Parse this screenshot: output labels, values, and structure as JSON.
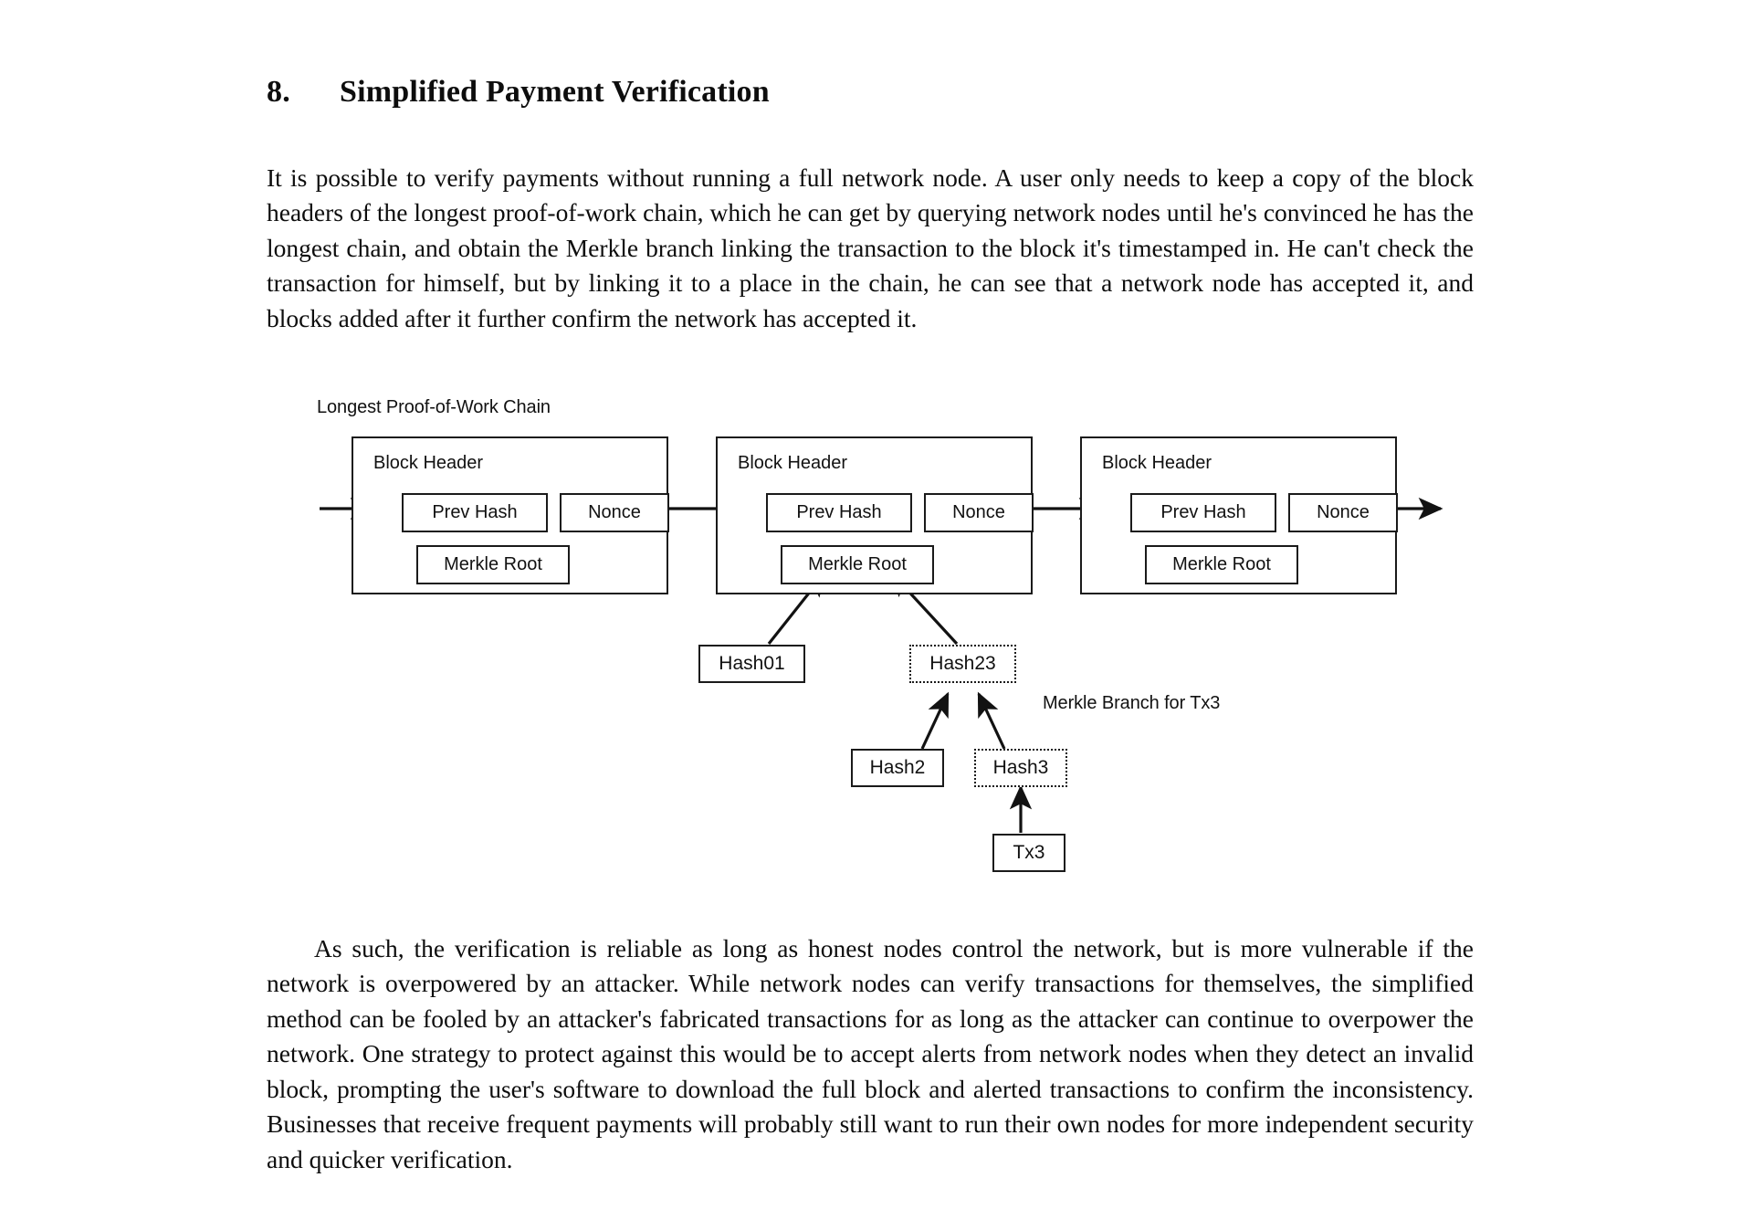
{
  "page": {
    "background": "#ffffff",
    "ink": "#0d0d0d"
  },
  "heading": {
    "number": "8.",
    "title": "Simplified Payment Verification"
  },
  "paragraphs": {
    "intro": "It is possible to verify payments without running a full network node.  A user only needs to keep a copy of the block headers of the longest proof-of-work chain, which he can get by querying network nodes until he's convinced he has the longest chain, and obtain the Merkle branch linking the transaction to the block it's timestamped in.   He can't check the transaction for himself, but by linking it to a place in the chain, he can see that a network node has accepted it, and blocks added after it further confirm the network has accepted it.",
    "closing": "As such, the verification is reliable as long as honest nodes control the network, but is more vulnerable if the network is overpowered by an attacker.   While network nodes can verify transactions for themselves, the simplified method can be fooled by an attacker's fabricated transactions for as long as the attacker can continue to overpower the network.  One strategy to protect against this would be to accept alerts from network nodes when they detect an invalid block, prompting the user's software to download the full block and alerted transactions to confirm the inconsistency.  Businesses that receive frequent payments will probably still want to run their own nodes for more independent security and quicker verification."
  },
  "diagram": {
    "chain_label": "Longest Proof-of-Work Chain",
    "branch_label": "Merkle Branch for Tx3",
    "block_title": "Block Header",
    "field_prev_hash": "Prev Hash",
    "field_nonce": "Nonce",
    "field_merkle_root": "Merkle Root",
    "blocks": [
      {
        "title": "Block Header",
        "prev_hash": "Prev Hash",
        "nonce": "Nonce",
        "merkle_root": "Merkle Root"
      },
      {
        "title": "Block Header",
        "prev_hash": "Prev Hash",
        "nonce": "Nonce",
        "merkle_root": "Merkle Root"
      },
      {
        "title": "Block Header",
        "prev_hash": "Prev Hash",
        "nonce": "Nonce",
        "merkle_root": "Merkle Root"
      }
    ],
    "tree": {
      "hash01": "Hash01",
      "hash23": "Hash23",
      "hash2": "Hash2",
      "hash3": "Hash3",
      "tx3": "Tx3"
    },
    "stroke_color": "#1a1a1a"
  }
}
